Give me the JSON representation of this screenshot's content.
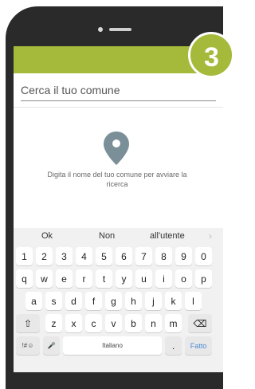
{
  "step": {
    "number": "3"
  },
  "search": {
    "placeholder": "Cerca il tuo comune"
  },
  "empty_state": {
    "message": "Digita il nome del tuo comune per avviare la ricerca"
  },
  "keyboard": {
    "suggestions": [
      "Ok",
      "Non",
      "all'utente"
    ],
    "suggestion_more": "›",
    "number_row": [
      "1",
      "2",
      "3",
      "4",
      "5",
      "6",
      "7",
      "8",
      "9",
      "0"
    ],
    "row1": [
      "q",
      "w",
      "e",
      "r",
      "t",
      "y",
      "u",
      "i",
      "o",
      "p"
    ],
    "row2": [
      "a",
      "s",
      "d",
      "f",
      "g",
      "h",
      "j",
      "k",
      "l"
    ],
    "shift_icon": "⇧",
    "row3": [
      "z",
      "x",
      "c",
      "v",
      "b",
      "n",
      "m"
    ],
    "backspace_icon": "⌫",
    "symbols_key": "!#☺",
    "mic_icon": "🎤",
    "space_label": "Italiano",
    "period_key": ".",
    "done_key": "Fatto"
  },
  "colors": {
    "accent": "#a5b93a",
    "pin": "#7a8f97",
    "frame": "#2a2a2a"
  }
}
